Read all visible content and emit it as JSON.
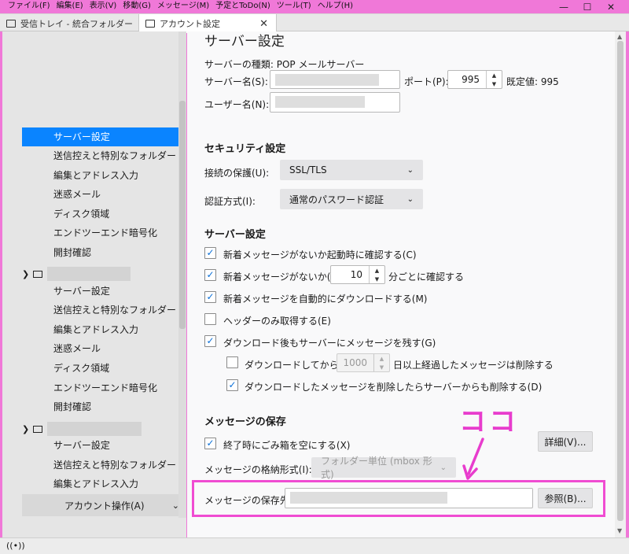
{
  "menu": [
    "ファイル(F)",
    "編集(E)",
    "表示(V)",
    "移動(G)",
    "メッセージ(M)",
    "予定とToDo(N)",
    "ツール(T)",
    "ヘルプ(H)"
  ],
  "window_controls": {
    "minimize": "—",
    "maximize": "☐",
    "close": "✕"
  },
  "tabs": [
    {
      "label": "受信トレイ - 統合フォルダー",
      "active": false
    },
    {
      "label": "アカウント設定",
      "active": true
    }
  ],
  "sidebar": {
    "group1": [
      "サーバー設定",
      "送信控えと特別なフォルダー",
      "編集とアドレス入力",
      "迷惑メール",
      "ディスク領域",
      "エンドツーエンド暗号化",
      "開封確認"
    ],
    "group2": [
      "サーバー設定",
      "送信控えと特別なフォルダー",
      "編集とアドレス入力",
      "迷惑メール",
      "ディスク領域",
      "エンドツーエンド暗号化",
      "開封確認"
    ],
    "group3": [
      "サーバー設定",
      "送信控えと特別なフォルダー",
      "編集とアドレス入力"
    ],
    "account_ops": "アカウント操作(A)"
  },
  "main": {
    "title": "サーバー設定",
    "server_type": "サーバーの種類: POP メールサーバー",
    "server_name_label": "サーバー名(S):",
    "port_label": "ポート(P):",
    "port_value": "995",
    "port_default": "既定値: 995",
    "user_name_label": "ユーザー名(N):",
    "security_heading": "セキュリティ設定",
    "conn_security_label": "接続の保護(U):",
    "conn_security_value": "SSL/TLS",
    "auth_label": "認証方式(I):",
    "auth_value": "通常のパスワード認証",
    "server_settings_heading": "サーバー設定",
    "check_startup": "新着メッセージがないか起動時に確認する(C)",
    "check_every": "新着メッセージがないか(Y)",
    "check_every_value": "10",
    "check_every_suffix": "分ごとに確認する",
    "auto_download": "新着メッセージを自動的にダウンロードする(M)",
    "headers_only": "ヘッダーのみ取得する(E)",
    "leave_on_server": "ダウンロード後もサーバーにメッセージを残す(G)",
    "delete_after": "ダウンロードしてから(O)",
    "delete_after_value": "1000",
    "delete_after_suffix": "日以上経過したメッセージは削除する",
    "delete_when_deleted": "ダウンロードしたメッセージを削除したらサーバーからも削除する(D)",
    "storage_heading": "メッセージの保存",
    "empty_trash": "終了時にごみ箱を空にする(X)",
    "advanced_button": "詳細(V)...",
    "store_type_label": "メッセージの格納形式(I):",
    "store_type_value": "フォルダー単位 (mbox 形式)",
    "local_dir_label": "メッセージの保存先:",
    "browse_button": "参照(B)..."
  },
  "annotation": "ココ",
  "status_icon": "((•))"
}
